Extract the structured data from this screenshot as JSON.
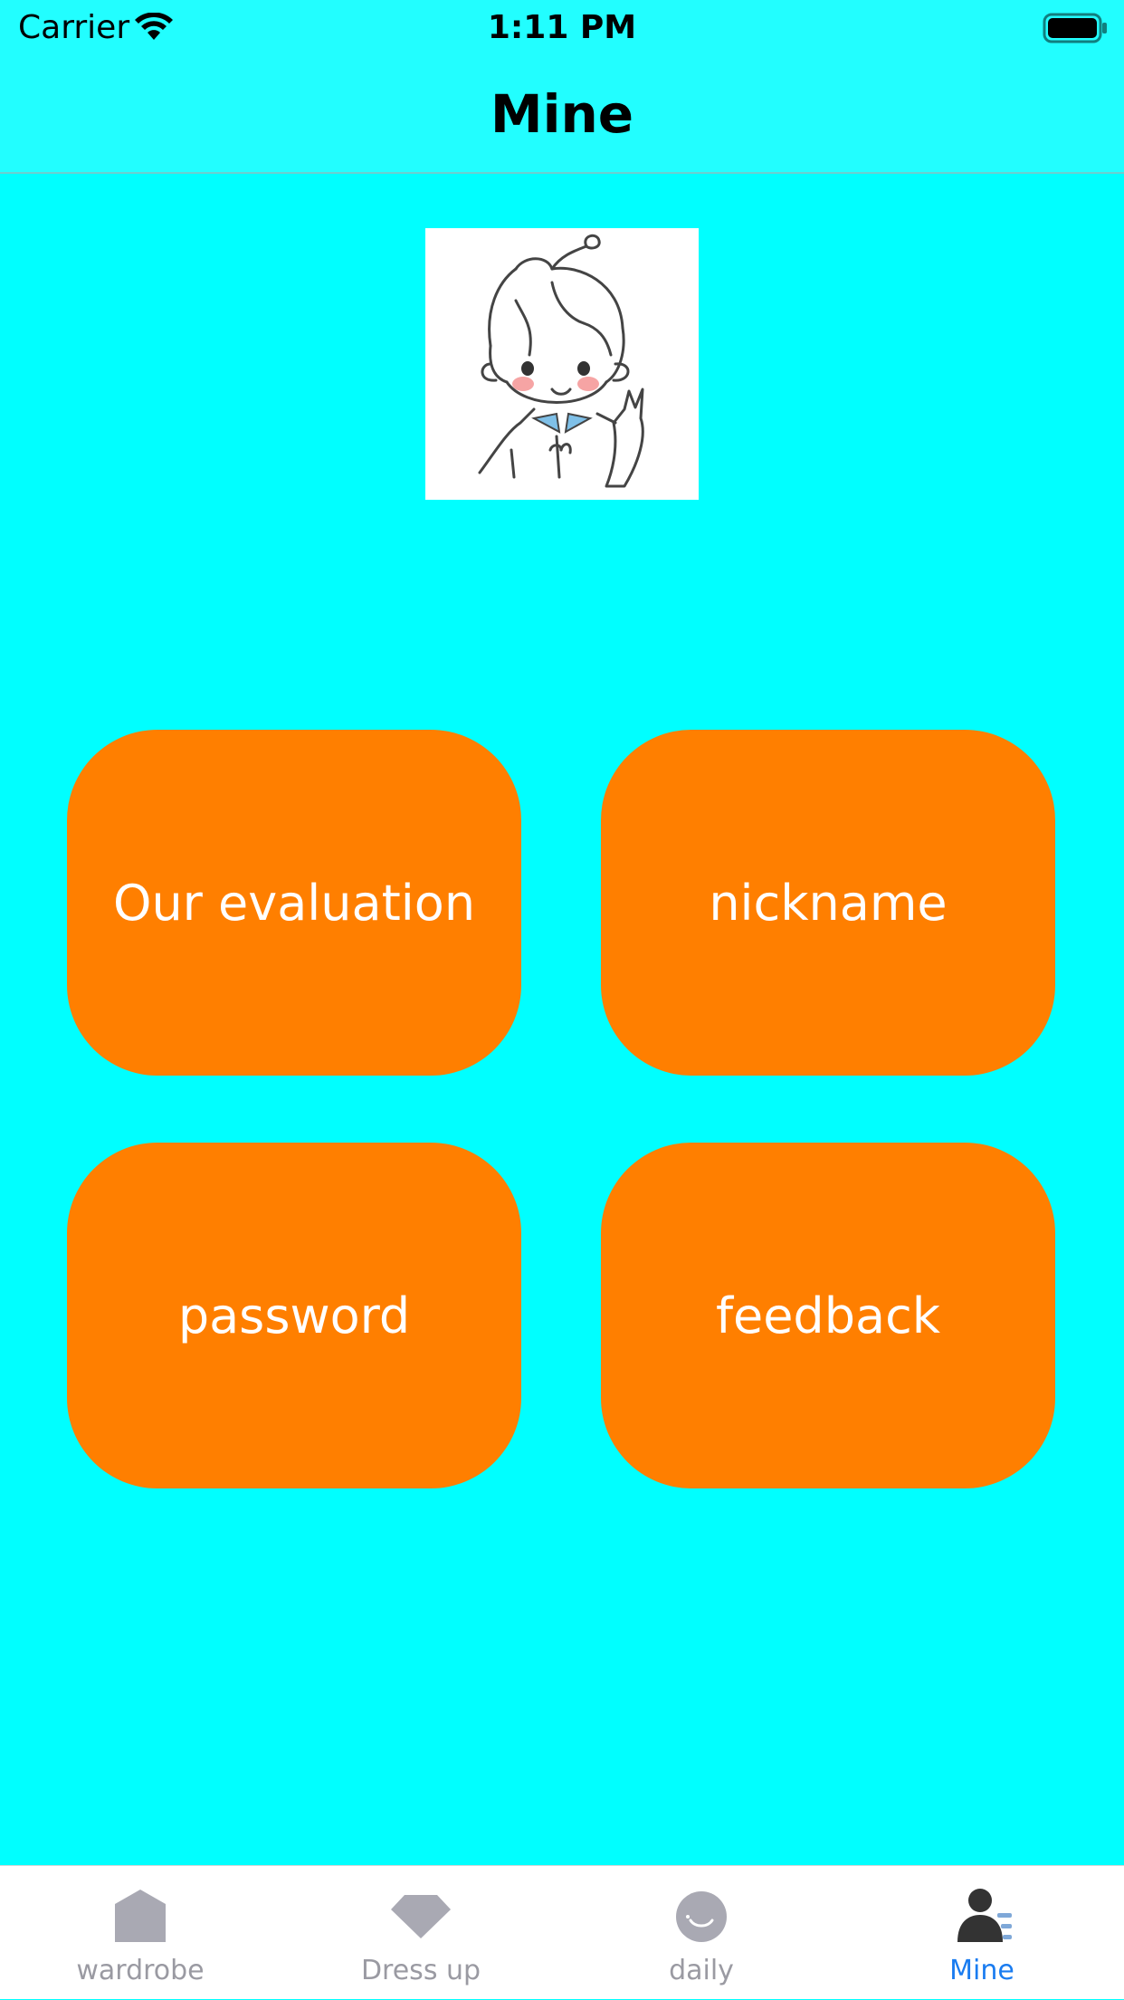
{
  "status_bar": {
    "carrier": "Carrier",
    "time": "1:11 PM"
  },
  "nav": {
    "title": "Mine"
  },
  "avatar": {
    "description_icon": "avatar-illustration"
  },
  "tiles": [
    {
      "label": "Our evaluation"
    },
    {
      "label": "nickname"
    },
    {
      "label": "password"
    },
    {
      "label": "feedback"
    }
  ],
  "tabbar": {
    "items": [
      {
        "label": "wardrobe",
        "icon": "house-icon",
        "active": false
      },
      {
        "label": "Dress up",
        "icon": "diamond-icon",
        "active": false
      },
      {
        "label": "daily",
        "icon": "smile-icon",
        "active": false
      },
      {
        "label": "Mine",
        "icon": "person-icon",
        "active": true
      }
    ]
  },
  "colors": {
    "background": "#00ffff",
    "header": "#22feff",
    "tile": "#ff7f00",
    "tab_active": "#1a7cf0",
    "tab_inactive": "#9a9aa2"
  }
}
